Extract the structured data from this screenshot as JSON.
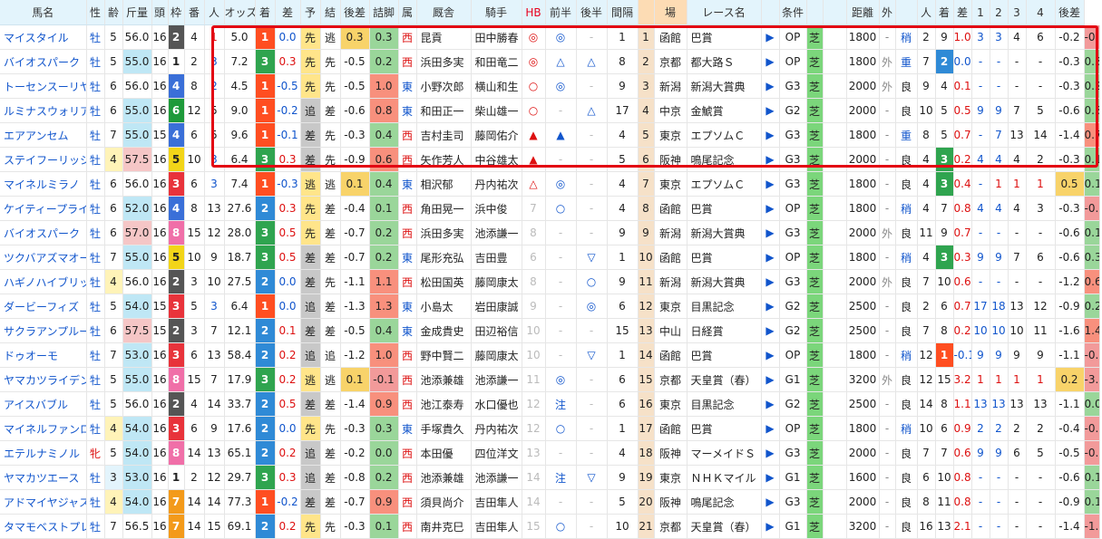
{
  "headers": [
    "馬名",
    "性",
    "齢",
    "斤量",
    "頭",
    "枠",
    "番",
    "人",
    "オッズ",
    "着",
    "差",
    "予",
    "結",
    "後差",
    "詰脚",
    "属",
    "厩舎",
    "騎手",
    "HB",
    "前半",
    "後半",
    "間隔",
    "場",
    "レース名",
    "",
    "条件",
    "",
    "距離",
    "外",
    "",
    "人",
    "着",
    "差",
    "1",
    "2",
    "3",
    "4",
    "後差",
    "詰脚"
  ],
  "rows": [
    {
      "name": "マイスタイル",
      "sex": "牡",
      "age": "5",
      "kin": "56.0",
      "tou": "16",
      "waku": "2",
      "ban": "4",
      "nin": "1",
      "odds": "5.0",
      "chaku": "1",
      "sa": "0.0",
      "yo": "先",
      "ke": "逃",
      "kosa": "0.3",
      "tsume": "0.3",
      "zoku": "西",
      "kyusha": "昆貢",
      "kishu": "田中勝春",
      "hb": "◎",
      "zen": "◎",
      "kou": "-",
      "kan": "1",
      "rno": "1",
      "ba": "函館",
      "race": "巴賞",
      "cls": "OP",
      "surf": "芝",
      "dist": "1800",
      "out": "-",
      "baba": "稍",
      "rnin": "2",
      "rchaku": "9",
      "rsa": "1.0",
      "c1": "3",
      "c2": "3",
      "c3": "4",
      "c4": "6",
      "rkosa": "-0.2",
      "rtsume": "-0.8"
    },
    {
      "name": "バイオスパーク",
      "sex": "牡",
      "age": "5",
      "kin": "55.0",
      "tou": "16",
      "waku": "1",
      "ban": "2",
      "nin": "3",
      "odds": "7.2",
      "chaku": "3",
      "sa": "0.3",
      "yo": "先",
      "ke": "先",
      "kosa": "-0.5",
      "tsume": "0.2",
      "zoku": "西",
      "kyusha": "浜田多実",
      "kishu": "和田竜二",
      "hb": "◎",
      "zen": "△",
      "kou": "△",
      "kan": "8",
      "rno": "2",
      "ba": "京都",
      "race": "都大路Ｓ",
      "cls": "OP",
      "surf": "芝",
      "dist": "1800",
      "out": "外",
      "baba": "重",
      "rnin": "7",
      "rchaku": "2",
      "rsa": "0.0",
      "c1": "-",
      "c2": "-",
      "c3": "-",
      "c4": "-",
      "rkosa": "-0.3",
      "rtsume": "0.3"
    },
    {
      "name": "トーセンスーリヤ",
      "sex": "牡",
      "age": "6",
      "kin": "56.0",
      "tou": "16",
      "waku": "4",
      "ban": "8",
      "nin": "2",
      "odds": "4.5",
      "chaku": "1",
      "sa": "-0.5",
      "yo": "先",
      "ke": "先",
      "kosa": "-0.5",
      "tsume": "1.0",
      "zoku": "東",
      "kyusha": "小野次郎",
      "kishu": "横山和生",
      "hb": "○",
      "zen": "◎",
      "kou": "-",
      "kan": "9",
      "rno": "3",
      "ba": "新潟",
      "race": "新潟大賞典",
      "cls": "G3",
      "surf": "芝",
      "dist": "2000",
      "out": "外",
      "baba": "良",
      "rnin": "9",
      "rchaku": "4",
      "rsa": "0.1",
      "c1": "-",
      "c2": "-",
      "c3": "-",
      "c4": "-",
      "rkosa": "-0.3",
      "rtsume": "0.2"
    },
    {
      "name": "ルミナスウォリアー",
      "sex": "牡",
      "age": "6",
      "kin": "55.0",
      "tou": "16",
      "waku": "6",
      "ban": "12",
      "nin": "5",
      "odds": "9.0",
      "chaku": "1",
      "sa": "-0.2",
      "yo": "追",
      "ke": "差",
      "kosa": "-0.6",
      "tsume": "0.8",
      "zoku": "東",
      "kyusha": "和田正一",
      "kishu": "柴山雄一",
      "hb": "○",
      "zen": "-",
      "kou": "△",
      "kan": "17",
      "rno": "4",
      "ba": "中京",
      "race": "金鯱賞",
      "cls": "G2",
      "surf": "芝",
      "dist": "2000",
      "out": "-",
      "baba": "良",
      "rnin": "10",
      "rchaku": "5",
      "rsa": "0.5",
      "c1": "9",
      "c2": "9",
      "c3": "7",
      "c4": "5",
      "rkosa": "-0.6",
      "rtsume": "0.3"
    },
    {
      "name": "エアアンセム",
      "sex": "牡",
      "age": "7",
      "kin": "55.0",
      "tou": "15",
      "waku": "4",
      "ban": "6",
      "nin": "5",
      "odds": "9.6",
      "chaku": "1",
      "sa": "-0.1",
      "yo": "差",
      "ke": "先",
      "kosa": "-0.3",
      "tsume": "0.4",
      "zoku": "西",
      "kyusha": "吉村圭司",
      "kishu": "藤岡佑介",
      "hb": "▲",
      "zen": "▲",
      "kou": "-",
      "kan": "4",
      "rno": "5",
      "ba": "東京",
      "race": "エプソムＣ",
      "cls": "G3",
      "surf": "芝",
      "dist": "1800",
      "out": "-",
      "baba": "重",
      "rnin": "8",
      "rchaku": "5",
      "rsa": "0.7",
      "c1": "-",
      "c2": "7",
      "c3": "13",
      "c4": "14",
      "rkosa": "-1.4",
      "rtsume": "0.7"
    },
    {
      "name": "ステイフーリッシュ",
      "sex": "牡",
      "age": "4",
      "kin": "57.5",
      "tou": "16",
      "waku": "5",
      "ban": "10",
      "nin": "3",
      "odds": "6.4",
      "chaku": "3",
      "sa": "0.3",
      "yo": "差",
      "ke": "先",
      "kosa": "-0.9",
      "tsume": "0.6",
      "zoku": "西",
      "kyusha": "矢作芳人",
      "kishu": "中谷雄太",
      "hb": "▲",
      "zen": "-",
      "kou": "-",
      "kan": "5",
      "rno": "6",
      "ba": "阪神",
      "race": "鳴尾記念",
      "cls": "G3",
      "surf": "芝",
      "dist": "2000",
      "out": "-",
      "baba": "良",
      "rnin": "4",
      "rchaku": "3",
      "rsa": "0.2",
      "c1": "4",
      "c2": "4",
      "c3": "4",
      "c4": "2",
      "rkosa": "-0.3",
      "rtsume": "0.1"
    },
    {
      "name": "マイネルミラノ",
      "sex": "牡",
      "age": "6",
      "kin": "56.0",
      "tou": "16",
      "waku": "3",
      "ban": "6",
      "nin": "3",
      "odds": "7.4",
      "chaku": "1",
      "sa": "-0.3",
      "yo": "逃",
      "ke": "逃",
      "kosa": "0.1",
      "tsume": "0.4",
      "zoku": "東",
      "kyusha": "相沢郁",
      "kishu": "丹内祐次",
      "hb": "△",
      "zen": "◎",
      "kou": "-",
      "kan": "4",
      "rno": "7",
      "ba": "東京",
      "race": "エプソムＣ",
      "cls": "G3",
      "surf": "芝",
      "dist": "1800",
      "out": "-",
      "baba": "良",
      "rnin": "4",
      "rchaku": "3",
      "rsa": "0.4",
      "c1": "-",
      "c2": "1",
      "c3": "1",
      "c4": "1",
      "rkosa": "0.5",
      "rtsume": "0.1"
    },
    {
      "name": "ケイティープライド",
      "sex": "牡",
      "age": "6",
      "kin": "52.0",
      "tou": "16",
      "waku": "4",
      "ban": "8",
      "nin": "13",
      "odds": "27.6",
      "chaku": "2",
      "sa": "0.3",
      "yo": "先",
      "ke": "差",
      "kosa": "-0.4",
      "tsume": "0.1",
      "zoku": "西",
      "kyusha": "角田晃一",
      "kishu": "浜中俊",
      "hb": "7",
      "zen": "○",
      "kou": "-",
      "kan": "4",
      "rno": "8",
      "ba": "函館",
      "race": "巴賞",
      "cls": "OP",
      "surf": "芝",
      "dist": "1800",
      "out": "-",
      "baba": "稍",
      "rnin": "4",
      "rchaku": "7",
      "rsa": "0.8",
      "c1": "4",
      "c2": "4",
      "c3": "4",
      "c4": "3",
      "rkosa": "-0.3",
      "rtsume": "-0.5"
    },
    {
      "name": "バイオスパーク",
      "sex": "牡",
      "age": "6",
      "kin": "57.0",
      "tou": "16",
      "waku": "8",
      "ban": "15",
      "nin": "12",
      "odds": "28.0",
      "chaku": "3",
      "sa": "0.5",
      "yo": "先",
      "ke": "差",
      "kosa": "-0.7",
      "tsume": "0.2",
      "zoku": "西",
      "kyusha": "浜田多実",
      "kishu": "池添謙一",
      "hb": "8",
      "zen": "-",
      "kou": "-",
      "kan": "9",
      "rno": "9",
      "ba": "新潟",
      "race": "新潟大賞典",
      "cls": "G3",
      "surf": "芝",
      "dist": "2000",
      "out": "外",
      "baba": "良",
      "rnin": "11",
      "rchaku": "9",
      "rsa": "0.7",
      "c1": "-",
      "c2": "-",
      "c3": "-",
      "c4": "-",
      "rkosa": "-0.6",
      "rtsume": "0.1"
    },
    {
      "name": "ツクバアズマオー",
      "sex": "牡",
      "age": "7",
      "kin": "55.0",
      "tou": "16",
      "waku": "5",
      "ban": "10",
      "nin": "9",
      "odds": "18.7",
      "chaku": "3",
      "sa": "0.5",
      "yo": "差",
      "ke": "差",
      "kosa": "-0.7",
      "tsume": "0.2",
      "zoku": "東",
      "kyusha": "尾形充弘",
      "kishu": "吉田豊",
      "hb": "6",
      "zen": "-",
      "kou": "▽",
      "kan": "1",
      "rno": "10",
      "ba": "函館",
      "race": "巴賞",
      "cls": "OP",
      "surf": "芝",
      "dist": "1800",
      "out": "-",
      "baba": "稍",
      "rnin": "4",
      "rchaku": "3",
      "rsa": "0.3",
      "c1": "9",
      "c2": "9",
      "c3": "7",
      "c4": "6",
      "rkosa": "-0.6",
      "rtsume": "0.3"
    },
    {
      "name": "ハギノハイブリッド",
      "sex": "牡",
      "age": "4",
      "kin": "56.0",
      "tou": "16",
      "waku": "2",
      "ban": "3",
      "nin": "10",
      "odds": "27.5",
      "chaku": "2",
      "sa": "0.0",
      "yo": "差",
      "ke": "先",
      "kosa": "-1.1",
      "tsume": "1.1",
      "zoku": "西",
      "kyusha": "松田国英",
      "kishu": "藤岡康太",
      "hb": "8",
      "zen": "-",
      "kou": "○",
      "kan": "9",
      "rno": "11",
      "ba": "新潟",
      "race": "新潟大賞典",
      "cls": "G3",
      "surf": "芝",
      "dist": "2000",
      "out": "外",
      "baba": "良",
      "rnin": "7",
      "rchaku": "10",
      "rsa": "0.6",
      "c1": "-",
      "c2": "-",
      "c3": "-",
      "c4": "-",
      "rkosa": "-1.2",
      "rtsume": "0.6"
    },
    {
      "name": "ダービーフィズ",
      "sex": "牡",
      "age": "5",
      "kin": "54.0",
      "tou": "15",
      "waku": "3",
      "ban": "5",
      "nin": "3",
      "odds": "6.4",
      "chaku": "1",
      "sa": "0.0",
      "yo": "追",
      "ke": "差",
      "kosa": "-1.3",
      "tsume": "1.3",
      "zoku": "東",
      "kyusha": "小島太",
      "kishu": "岩田康誠",
      "hb": "9",
      "zen": "-",
      "kou": "◎",
      "kan": "6",
      "rno": "12",
      "ba": "東京",
      "race": "目黒記念",
      "cls": "G2",
      "surf": "芝",
      "dist": "2500",
      "out": "-",
      "baba": "良",
      "rnin": "2",
      "rchaku": "6",
      "rsa": "0.7",
      "c1": "17",
      "c2": "18",
      "c3": "13",
      "c4": "12",
      "rkosa": "-0.9",
      "rtsume": "0.2"
    },
    {
      "name": "サクラアンプルール",
      "sex": "牡",
      "age": "6",
      "kin": "57.5",
      "tou": "15",
      "waku": "2",
      "ban": "3",
      "nin": "7",
      "odds": "12.1",
      "chaku": "2",
      "sa": "0.1",
      "yo": "差",
      "ke": "差",
      "kosa": "-0.5",
      "tsume": "0.4",
      "zoku": "東",
      "kyusha": "金成貴史",
      "kishu": "田辺裕信",
      "hb": "10",
      "zen": "-",
      "kou": "-",
      "kan": "15",
      "rno": "13",
      "ba": "中山",
      "race": "日経賞",
      "cls": "G2",
      "surf": "芝",
      "dist": "2500",
      "out": "-",
      "baba": "良",
      "rnin": "7",
      "rchaku": "8",
      "rsa": "0.2",
      "c1": "10",
      "c2": "10",
      "c3": "10",
      "c4": "11",
      "rkosa": "-1.6",
      "rtsume": "1.4"
    },
    {
      "name": "ドゥオーモ",
      "sex": "牡",
      "age": "7",
      "kin": "53.0",
      "tou": "16",
      "waku": "3",
      "ban": "6",
      "nin": "13",
      "odds": "58.4",
      "chaku": "2",
      "sa": "0.2",
      "yo": "追",
      "ke": "追",
      "kosa": "-1.2",
      "tsume": "1.0",
      "zoku": "西",
      "kyusha": "野中賢二",
      "kishu": "藤岡康太",
      "hb": "10",
      "zen": "-",
      "kou": "▽",
      "kan": "1",
      "rno": "14",
      "ba": "函館",
      "race": "巴賞",
      "cls": "OP",
      "surf": "芝",
      "dist": "1800",
      "out": "-",
      "baba": "稍",
      "rnin": "12",
      "rchaku": "1",
      "rsa": "-0.1",
      "c1": "9",
      "c2": "9",
      "c3": "9",
      "c4": "9",
      "rkosa": "-1.1",
      "rtsume": "-0.1"
    },
    {
      "name": "ヤマカツライデン",
      "sex": "牡",
      "age": "5",
      "kin": "55.0",
      "tou": "16",
      "waku": "8",
      "ban": "15",
      "nin": "7",
      "odds": "17.9",
      "chaku": "3",
      "sa": "0.2",
      "yo": "逃",
      "ke": "逃",
      "kosa": "0.1",
      "tsume": "-0.1",
      "zoku": "西",
      "kyusha": "池添兼雄",
      "kishu": "池添謙一",
      "hb": "11",
      "zen": "◎",
      "kou": "-",
      "kan": "6",
      "rno": "15",
      "ba": "京都",
      "race": "天皇賞（春）",
      "cls": "G1",
      "surf": "芝",
      "dist": "3200",
      "out": "外",
      "baba": "良",
      "rnin": "12",
      "rchaku": "15",
      "rsa": "3.2",
      "c1": "1",
      "c2": "1",
      "c3": "1",
      "c4": "1",
      "rkosa": "0.2",
      "rtsume": "-3.0"
    },
    {
      "name": "アイスバブル",
      "sex": "牡",
      "age": "5",
      "kin": "56.0",
      "tou": "16",
      "waku": "2",
      "ban": "4",
      "nin": "14",
      "odds": "33.7",
      "chaku": "2",
      "sa": "0.5",
      "yo": "差",
      "ke": "差",
      "kosa": "-1.4",
      "tsume": "0.9",
      "zoku": "西",
      "kyusha": "池江泰寿",
      "kishu": "水口優也",
      "hb": "12",
      "zen": "注",
      "kou": "-",
      "kan": "6",
      "rno": "16",
      "ba": "東京",
      "race": "目黒記念",
      "cls": "G2",
      "surf": "芝",
      "dist": "2500",
      "out": "-",
      "baba": "良",
      "rnin": "14",
      "rchaku": "8",
      "rsa": "1.1",
      "c1": "13",
      "c2": "13",
      "c3": "13",
      "c4": "13",
      "rkosa": "-1.1",
      "rtsume": "0.0"
    },
    {
      "name": "マイネルファンロン",
      "sex": "牡",
      "age": "4",
      "kin": "54.0",
      "tou": "16",
      "waku": "3",
      "ban": "6",
      "nin": "9",
      "odds": "17.6",
      "chaku": "2",
      "sa": "0.0",
      "yo": "先",
      "ke": "先",
      "kosa": "-0.3",
      "tsume": "0.3",
      "zoku": "東",
      "kyusha": "手塚貴久",
      "kishu": "丹内祐次",
      "hb": "12",
      "zen": "○",
      "kou": "-",
      "kan": "1",
      "rno": "17",
      "ba": "函館",
      "race": "巴賞",
      "cls": "OP",
      "surf": "芝",
      "dist": "1800",
      "out": "-",
      "baba": "稍",
      "rnin": "10",
      "rchaku": "6",
      "rsa": "0.9",
      "c1": "2",
      "c2": "2",
      "c3": "2",
      "c4": "2",
      "rkosa": "-0.4",
      "rtsume": "-0.5"
    },
    {
      "name": "エテルナミノル",
      "sex": "牝",
      "age": "5",
      "kin": "54.0",
      "tou": "16",
      "waku": "8",
      "ban": "14",
      "nin": "13",
      "odds": "65.1",
      "chaku": "2",
      "sa": "0.2",
      "yo": "追",
      "ke": "差",
      "kosa": "-0.2",
      "tsume": "0.0",
      "zoku": "西",
      "kyusha": "本田優",
      "kishu": "四位洋文",
      "hb": "13",
      "zen": "-",
      "kou": "-",
      "kan": "4",
      "rno": "18",
      "ba": "阪神",
      "race": "マーメイドＳ",
      "cls": "G3",
      "surf": "芝",
      "dist": "2000",
      "out": "-",
      "baba": "良",
      "rnin": "7",
      "rchaku": "7",
      "rsa": "0.6",
      "c1": "9",
      "c2": "9",
      "c3": "6",
      "c4": "5",
      "rkosa": "-0.5",
      "rtsume": "-0.1"
    },
    {
      "name": "ヤマカツエース",
      "sex": "牡",
      "age": "3",
      "kin": "53.0",
      "tou": "16",
      "waku": "1",
      "ban": "2",
      "nin": "12",
      "odds": "29.7",
      "chaku": "3",
      "sa": "0.3",
      "yo": "追",
      "ke": "差",
      "kosa": "-0.8",
      "tsume": "0.2",
      "zoku": "西",
      "kyusha": "池添兼雄",
      "kishu": "池添謙一",
      "hb": "14",
      "zen": "注",
      "kou": "▽",
      "kan": "9",
      "rno": "19",
      "ba": "東京",
      "race": "ＮＨＫマイル",
      "cls": "G1",
      "surf": "芝",
      "dist": "1600",
      "out": "-",
      "baba": "良",
      "rnin": "6",
      "rchaku": "10",
      "rsa": "0.8",
      "c1": "-",
      "c2": "-",
      "c3": "-",
      "c4": "-",
      "rkosa": "-0.6",
      "rtsume": "0.1"
    },
    {
      "name": "アドマイヤジャスタ",
      "sex": "牡",
      "age": "4",
      "kin": "54.0",
      "tou": "16",
      "waku": "7",
      "ban": "14",
      "nin": "14",
      "odds": "77.3",
      "chaku": "1",
      "sa": "-0.2",
      "yo": "差",
      "ke": "差",
      "kosa": "-0.7",
      "tsume": "0.9",
      "zoku": "西",
      "kyusha": "須貝尚介",
      "kishu": "吉田隼人",
      "hb": "14",
      "zen": "-",
      "kou": "-",
      "kan": "5",
      "rno": "20",
      "ba": "阪神",
      "race": "鳴尾記念",
      "cls": "G3",
      "surf": "芝",
      "dist": "2000",
      "out": "-",
      "baba": "良",
      "rnin": "8",
      "rchaku": "11",
      "rsa": "0.8",
      "c1": "-",
      "c2": "-",
      "c3": "-",
      "c4": "-",
      "rkosa": "-0.9",
      "rtsume": "0.1"
    },
    {
      "name": "タマモベストプレイ",
      "sex": "牡",
      "age": "7",
      "kin": "56.5",
      "tou": "16",
      "waku": "7",
      "ban": "14",
      "nin": "15",
      "odds": "69.1",
      "chaku": "2",
      "sa": "0.2",
      "yo": "先",
      "ke": "先",
      "kosa": "-0.3",
      "tsume": "0.1",
      "zoku": "西",
      "kyusha": "南井克巳",
      "kishu": "吉田隼人",
      "hb": "15",
      "zen": "○",
      "kou": "-",
      "kan": "10",
      "rno": "21",
      "ba": "京都",
      "race": "天皇賞（春）",
      "cls": "G1",
      "surf": "芝",
      "dist": "3200",
      "out": "-",
      "baba": "良",
      "rnin": "16",
      "rchaku": "13",
      "rsa": "2.1",
      "c1": "-",
      "c2": "-",
      "c3": "-",
      "c4": "-",
      "rkosa": "-1.4",
      "rtsume": "-1.2"
    }
  ]
}
